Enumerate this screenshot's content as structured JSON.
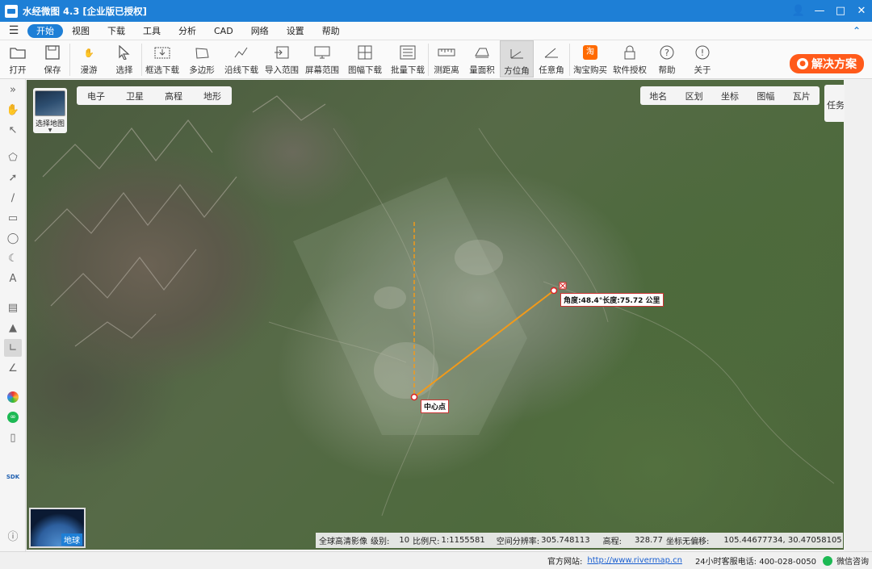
{
  "window": {
    "title": "水经微图 4.3 [企业版已授权]"
  },
  "menu": {
    "items": [
      "开始",
      "视图",
      "下载",
      "工具",
      "分析",
      "CAD",
      "网络",
      "设置",
      "帮助"
    ],
    "active": "开始"
  },
  "toolbar": {
    "open": "打开",
    "save": "保存",
    "pan": "漫游",
    "select": "选择",
    "box_download": "框选下载",
    "polygon": "多边形",
    "line_download": "沿线下载",
    "import_range": "导入范围",
    "screen_range": "屏幕范围",
    "sheet_download": "图幅下载",
    "batch_download": "批量下载",
    "measure_distance": "测距离",
    "measure_area": "量面积",
    "bearing": "方位角",
    "any_angle": "任意角",
    "taobao": "淘宝购买",
    "license": "软件授权",
    "help": "帮助",
    "about": "关于",
    "solution": "解决方案"
  },
  "map": {
    "select_map": "选择地图",
    "types": [
      "电子",
      "卫星",
      "高程",
      "地形"
    ],
    "overlays": [
      "地名",
      "区划",
      "坐标",
      "图幅",
      "瓦片"
    ],
    "tasks": "任务列表",
    "globe": "地球",
    "measure_label": "角度:48.4°长度:75.72 公里",
    "center_label": "中心点"
  },
  "status": {
    "imagery": "全球高清影像",
    "level_label": "级别:",
    "level": "10",
    "scale_label": "比例尺:",
    "scale": "1:1155581",
    "resolution_label": "空间分辨率:",
    "resolution": "305.748113",
    "elevation_label": "高程:",
    "elevation": "328.77",
    "coord_label": "坐标无偏移:",
    "coord": "105.44677734, 30.47058105"
  },
  "footer": {
    "site_label": "官方网站:",
    "site_url": "http://www.rivermap.cn",
    "phone": "24小时客服电话: 400-028-0050",
    "wechat": "微信咨询"
  },
  "colors": {
    "accent": "#1e7fd6",
    "solution": "#ff5a1a",
    "measure_line": "#f29a1a"
  }
}
